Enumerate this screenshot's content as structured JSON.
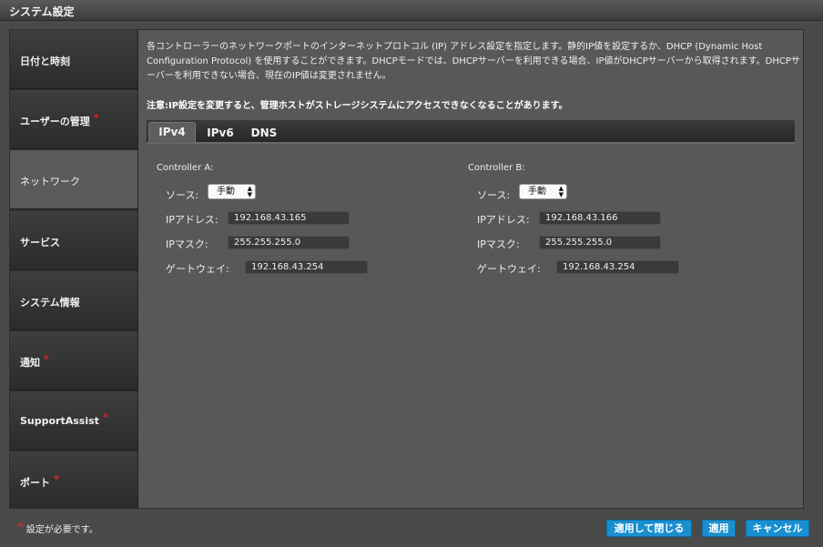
{
  "window": {
    "title": "システム設定"
  },
  "sidebar": {
    "items": [
      {
        "label": "日付と時刻",
        "required": false
      },
      {
        "label": "ユーザーの管理",
        "required": true
      },
      {
        "label": "ネットワーク",
        "required": false,
        "active": true
      },
      {
        "label": "サービス",
        "required": false
      },
      {
        "label": "システム情報",
        "required": false
      },
      {
        "label": "通知",
        "required": true
      },
      {
        "label": "SupportAssist",
        "required": true
      },
      {
        "label": "ポート",
        "required": true
      }
    ],
    "required_mark": "*"
  },
  "main": {
    "description": "各コントローラーのネットワークポートのインターネットプロトコル (IP) アドレス設定を指定します。静的IP値を設定するか、DHCP (Dynamic Host Configuration Protocol) を使用することができます。DHCPモードでは、DHCPサーバーを利用できる場合、IP値がDHCPサーバーから取得されます。DHCPサーバーを利用できない場合、現在のIP値は変更されません。",
    "warning": "注意:IP設定を変更すると、管理ホストがストレージシステムにアクセスできなくなることがあります。",
    "tabs": [
      {
        "label": "IPv4",
        "active": true
      },
      {
        "label": "IPv6",
        "active": false
      },
      {
        "label": "DNS",
        "active": false
      }
    ],
    "controllers": [
      {
        "title": "Controller A:",
        "source_label": "ソース:",
        "source_value": "手動",
        "ip_label": "IPアドレス:",
        "ip_value": "192.168.43.165",
        "mask_label": "IPマスク:",
        "mask_value": "255.255.255.0",
        "gateway_label": "ゲートウェイ:",
        "gateway_value": "192.168.43.254"
      },
      {
        "title": "Controller B:",
        "source_label": "ソース:",
        "source_value": "手動",
        "ip_label": "IPアドレス:",
        "ip_value": "192.168.43.166",
        "mask_label": "IPマスク:",
        "mask_value": "255.255.255.0",
        "gateway_label": "ゲートウェイ:",
        "gateway_value": "192.168.43.254"
      }
    ]
  },
  "footer": {
    "required_mark": "*",
    "note": "設定が必要です。",
    "apply_close_label": "適用して閉じる",
    "apply_label": "適用",
    "cancel_label": "キャンセル"
  },
  "colors": {
    "accent_button": "#1a8fd0",
    "required_mark": "#e0252b",
    "panel_bg": "#585858"
  },
  "icons": {
    "select_arrows": "updown-arrows-icon"
  }
}
